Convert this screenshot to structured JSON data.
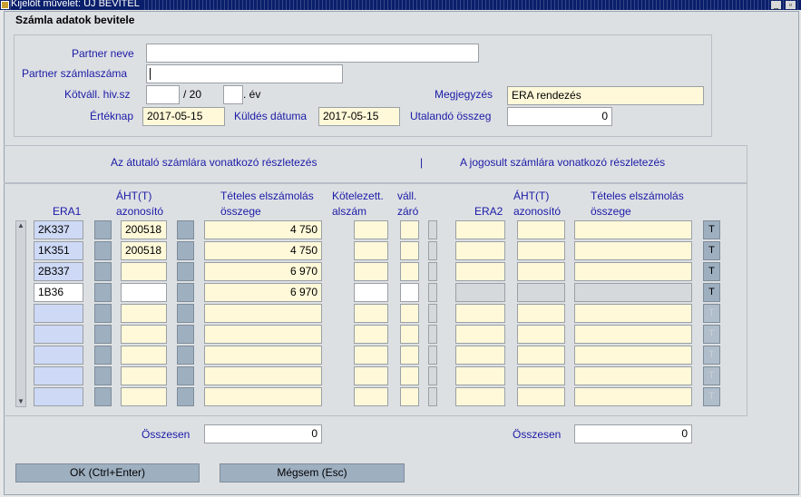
{
  "window": {
    "title": "Kijelölt művelet: ÚJ BEVITEL",
    "caption": "Számla adatok bevitele"
  },
  "header": {
    "partner_neve_label": "Partner neve",
    "partner_neve_value": "",
    "partner_szamlaszama_label": "Partner számlaszáma",
    "partner_szamlaszama_value": "",
    "kotvall_label": "Kötváll. hiv.sz",
    "kotvall_value": "",
    "kotvall_sep": "/ 20",
    "ev_value": "",
    "ev_label": ". év",
    "megjegyzes_label": "Megjegyzés",
    "megjegyzes_value": "ERA rendezés",
    "erteknap_label": "Értéknap",
    "erteknap_value": "2017-05-15",
    "kuldes_label": "Küldés dátuma",
    "kuldes_value": "2017-05-15",
    "utalando_label": "Utalandó összeg",
    "utalando_value": "0"
  },
  "section": {
    "left_title": "Az átutaló számlára vonatkozó részletezés",
    "divider": "|",
    "right_title": "A jogosult számlára vonatkozó részletezés"
  },
  "columns": {
    "era1": "ERA1",
    "aht1_line1": "ÁHT(T)",
    "aht1_line2": "azonosító",
    "teteles1_line1": "Tételes elszámolás",
    "teteles1_line2": "összege",
    "kotelezett_line1": "Kötelezett.",
    "kotelezett_line2": "alszám",
    "vall_line1": "váll.",
    "vall_line2": "záró",
    "era2": "ERA2",
    "aht2_line1": "ÁHT(T)",
    "aht2_line2": "azonosító",
    "teteles2_line1": "Tételes elszámolás",
    "teteles2_line2": "összege"
  },
  "rows": [
    {
      "era1": "2K337",
      "aht": "200518",
      "amount": "4 750",
      "t": "T"
    },
    {
      "era1": "1K351",
      "aht": "200518",
      "amount": "4 750",
      "t": "T"
    },
    {
      "era1": "2B337",
      "aht": "",
      "amount": "6 970",
      "t": "T"
    },
    {
      "era1": "1B36",
      "aht": "",
      "amount": "6 970",
      "t": "T"
    },
    {
      "era1": "",
      "aht": "",
      "amount": "",
      "t": "T"
    },
    {
      "era1": "",
      "aht": "",
      "amount": "",
      "t": "T"
    },
    {
      "era1": "",
      "aht": "",
      "amount": "",
      "t": "T"
    },
    {
      "era1": "",
      "aht": "",
      "amount": "",
      "t": "T"
    },
    {
      "era1": "",
      "aht": "",
      "amount": "",
      "t": "T"
    }
  ],
  "totals": {
    "left_label": "Összesen",
    "left_value": "0",
    "right_label": "Összesen",
    "right_value": "0"
  },
  "buttons": {
    "ok": "OK (Ctrl+Enter)",
    "cancel": "Mégsem (Esc)"
  }
}
